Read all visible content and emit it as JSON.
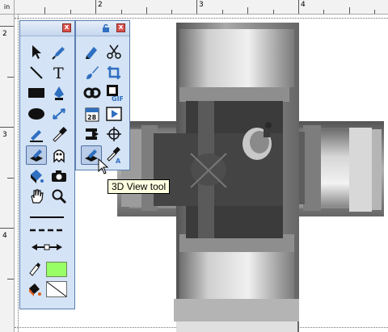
{
  "ruler": {
    "unit": "in",
    "top_labels": [
      "2",
      "3",
      "4"
    ],
    "left_labels": [
      "2",
      "3",
      "4"
    ]
  },
  "toolbox_left": {
    "close_label": "x",
    "tools": [
      {
        "name": "pick-tool-icon"
      },
      {
        "name": "freehand-pen-tool-icon"
      },
      {
        "name": "line-tool-icon"
      },
      {
        "name": "text-tool-icon"
      },
      {
        "name": "rectangle-tool-icon"
      },
      {
        "name": "pen-nib-tool-icon"
      },
      {
        "name": "ellipse-tool-icon"
      },
      {
        "name": "dimension-tool-icon"
      },
      {
        "name": "pencil-tool-icon"
      },
      {
        "name": "eyedropper-tool-icon"
      },
      {
        "name": "3d-view-tool-icon"
      },
      {
        "name": "ghost-tool-icon"
      },
      {
        "name": "paint-bucket-tool-icon"
      },
      {
        "name": "camera-tool-icon"
      },
      {
        "name": "hand-pan-tool-icon"
      },
      {
        "name": "zoom-tool-icon"
      }
    ],
    "fill_color": "#99ff66"
  },
  "toolbox_right": {
    "close_label": "x",
    "tools": [
      {
        "name": "marker-tool-icon"
      },
      {
        "name": "scissors-tool-icon"
      },
      {
        "name": "paint-brush-tool-icon"
      },
      {
        "name": "crop-tool-icon"
      },
      {
        "name": "link-tool-icon"
      },
      {
        "name": "gif-film-tool-icon"
      },
      {
        "name": "calendar-tool-icon",
        "text": "28"
      },
      {
        "name": "play-tool-icon"
      },
      {
        "name": "forward-tool-icon"
      },
      {
        "name": "crosshair-tool-icon"
      },
      {
        "name": "3d-view-tool-icon"
      },
      {
        "name": "eyedropper-text-tool-icon"
      }
    ]
  },
  "tooltip": {
    "text": "3D View tool"
  },
  "colors": {
    "panel_bg": "#d4e3f5",
    "panel_border": "#5a7fb0",
    "selected_tool_bg": "#b9cce8",
    "part_dark": "#3a3a3a",
    "part_mid": "#8a8a8a",
    "part_light": "#d8d8d8"
  }
}
